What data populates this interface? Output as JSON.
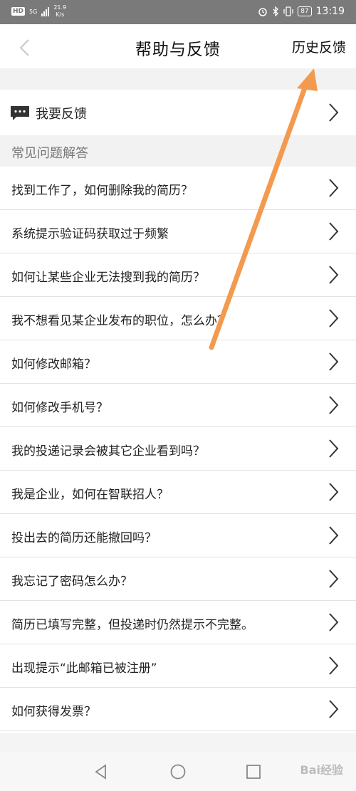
{
  "status_bar": {
    "hd": "HD",
    "network": "5G",
    "speed_value": "21.9",
    "speed_unit": "K/s",
    "battery": "87",
    "time": "13:19"
  },
  "header": {
    "title": "帮助与反馈",
    "history_label": "历史反馈"
  },
  "feedback": {
    "label": "我要反馈"
  },
  "faq": {
    "section_title": "常见问题解答",
    "items": [
      "找到工作了，如何删除我的简历？",
      "系统提示验证码获取过于频繁",
      "如何让某些企业无法搜到我的简历？",
      "我不想看见某企业发布的职位，怎么办？",
      "如何修改邮箱？",
      "如何修改手机号？",
      "我的投递记录会被其它企业看到吗？",
      "我是企业，如何在智联招人？",
      "投出去的简历还能撤回吗？",
      "我忘记了密码怎么办？",
      "简历已填写完整，但投递时仍然提示不完整。",
      "出现提示“此邮箱已被注册”",
      "如何获得发票？"
    ]
  },
  "watermark": "Bai经验",
  "colors": {
    "status_bar": "#7a7a7a",
    "section_bg": "#f2f2f2",
    "annotation_arrow": "#f39a4e"
  }
}
